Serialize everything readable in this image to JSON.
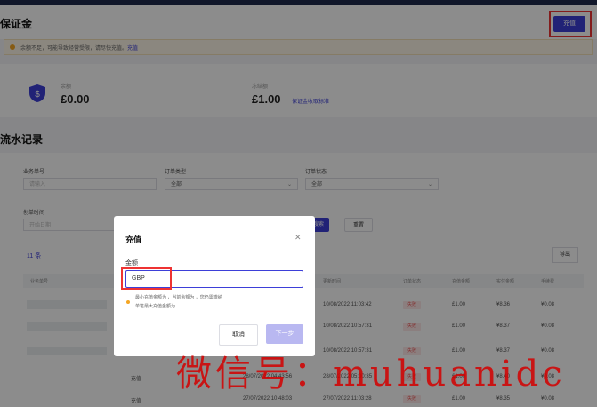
{
  "header": {
    "title": "保证金",
    "recharge_button": "充值"
  },
  "notice": {
    "text": "余额不足，可能导致经营受限，请尽快充值。",
    "link": "充值"
  },
  "balance": {
    "label": "余额",
    "value": "£0.00"
  },
  "frozen": {
    "label": "冻结额",
    "value": "£1.00",
    "link": "保证金收取标准"
  },
  "flow": {
    "title": "流水记录"
  },
  "filters": {
    "order_no_label": "业务单号",
    "order_no_placeholder": "请输入",
    "order_type_label": "订单类型",
    "order_type_value": "全部",
    "order_status_label": "订单状态",
    "order_status_value": "全部",
    "time_label": "创单时间",
    "time_placeholder": "开始日期",
    "search_button": "搜索",
    "reset_button": "重置"
  },
  "list": {
    "count_label": "11 条",
    "export_button": "导出",
    "columns": [
      "业务单号",
      "更新时间",
      "订单状态",
      "充值金额",
      "实付金额",
      "手续费"
    ],
    "rows": [
      {
        "type": "",
        "updated": "10/08/2022 11:03:42",
        "status": "失败",
        "amount": "£1.00",
        "paid": "¥8.36",
        "fee": "¥0.08"
      },
      {
        "type": "",
        "updated": "10/08/2022 10:57:31",
        "status": "失败",
        "amount": "£1.00",
        "paid": "¥8.37",
        "fee": "¥0.08"
      },
      {
        "type": "",
        "updated": "10/08/2022 10:57:31",
        "status": "失败",
        "amount": "£1.00",
        "paid": "¥8.37",
        "fee": "¥0.08"
      },
      {
        "type": "充值",
        "created": "28/07/2022 04:43:56",
        "updated": "28/07/2022 05:00:35",
        "status": "失败",
        "amount": "£1.00",
        "paid": "¥8.40",
        "fee": "¥0.08"
      },
      {
        "type": "充值",
        "created": "27/07/2022 10:48:03",
        "updated": "27/07/2022 11:03:28",
        "status": "失败",
        "amount": "£1.00",
        "paid": "¥8.35",
        "fee": "¥0.08"
      }
    ]
  },
  "modal": {
    "title": "充值",
    "close_icon": "close-icon",
    "amount_label": "金额",
    "currency": "GBP",
    "hint_line1": "最小充值金额为     ，当前余额为     ，您仍需缴纳",
    "hint_line2": "单笔最大充值金额为",
    "cancel_button": "取消",
    "next_button": "下一步"
  },
  "watermark": "微信号：muhuanidc",
  "colors": {
    "accent": "#3d3fd8",
    "highlight": "#e33333",
    "fail": "#e55555"
  }
}
